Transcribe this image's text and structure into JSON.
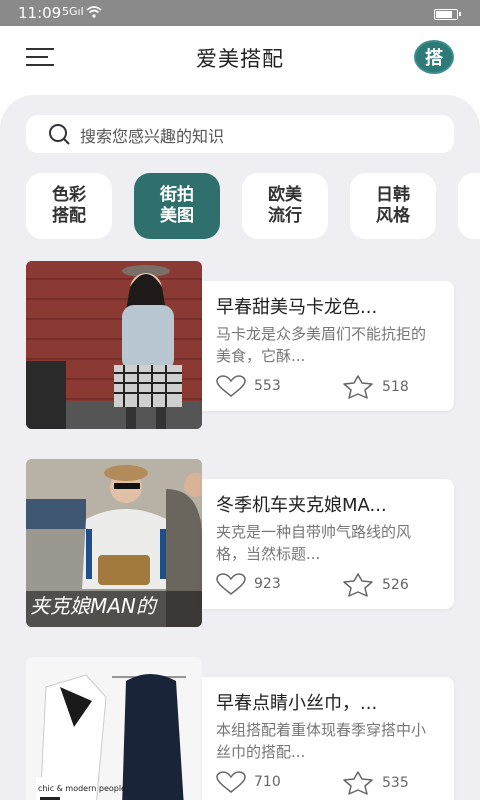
{
  "status_bar": {
    "time": "11:09",
    "signal": "5Gıl"
  },
  "app_bar": {
    "title": "爱美搭配",
    "badge": "搭"
  },
  "search": {
    "placeholder": "搜索您感兴趣的知识"
  },
  "categories": [
    {
      "line1": "色彩",
      "line2": "搭配",
      "active": false
    },
    {
      "line1": "街拍",
      "line2": "美图",
      "active": true
    },
    {
      "line1": "欧美",
      "line2": "流行",
      "active": false
    },
    {
      "line1": "日韩",
      "line2": "风格",
      "active": false
    }
  ],
  "articles": [
    {
      "title": "早春甜美马卡龙色...",
      "desc": "马卡龙是众多美眉们不能抗拒的美食，它酥...",
      "likes": "553",
      "favorites": "518"
    },
    {
      "title": "冬季机车夹克娘MA...",
      "desc": "夹克是一种自带帅气路线的风格，当然标题...",
      "likes": "923",
      "favorites": "526",
      "photo_caption": "夹克娘MAN的"
    },
    {
      "title": "早春点睛小丝巾，...",
      "desc": "本组搭配着重体现春季穿搭中小丝巾的搭配...",
      "likes": "710",
      "favorites": "535",
      "photo_caption": "chic & modern people"
    }
  ],
  "colors": {
    "accent": "#2f706c",
    "background": "#efeff3"
  }
}
